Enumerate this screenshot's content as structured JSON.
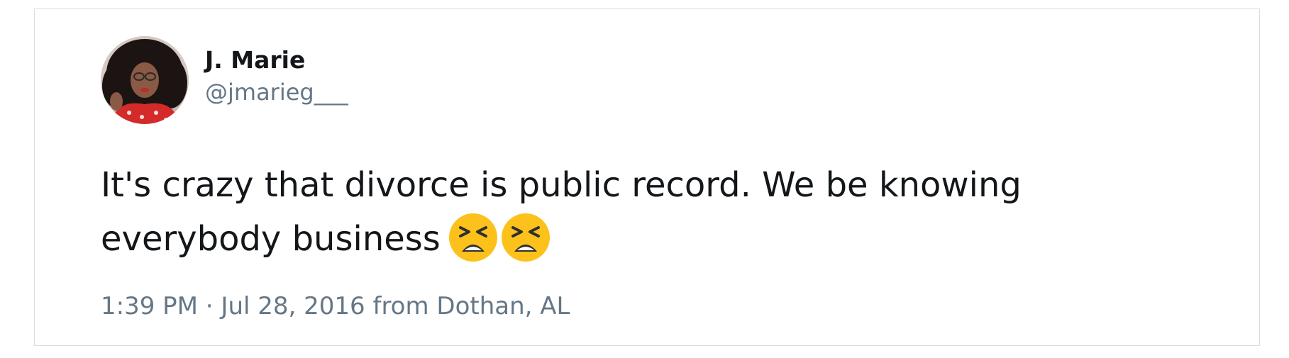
{
  "tweet": {
    "author": {
      "display_name": "J. Marie",
      "handle": "@jmarieg___",
      "avatar_icon": "profile-photo"
    },
    "text_line_1": "It's crazy that divorce is public record. We be knowing",
    "text_line_2": "everybody business",
    "emojis": [
      "tired-face-emoji",
      "tired-face-emoji"
    ],
    "timestamp": "1:39 PM · Jul 28, 2016",
    "source": "from Dothan, AL"
  },
  "colors": {
    "text": "#14171a",
    "secondary": "#657786",
    "border": "#d8dde1",
    "emoji_face": "#fcc21b"
  }
}
